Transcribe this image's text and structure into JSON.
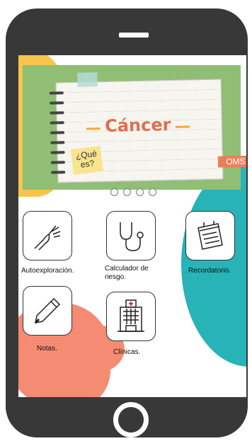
{
  "banner": {
    "title": "Cáncer",
    "sticky": "¿Qué es?",
    "badge": "OMS"
  },
  "carousel": {
    "pages": 4
  },
  "menu": [
    {
      "label": "Autoexploración.",
      "icon": "hand-icon"
    },
    {
      "label": "Calculador de riesgo.",
      "icon": "stethoscope-icon"
    },
    {
      "label": "Recordatorio.",
      "icon": "calendar-icon"
    },
    {
      "label": "Notas.",
      "icon": "pencil-icon"
    },
    {
      "label": "Clínicas.",
      "icon": "hospital-icon"
    }
  ],
  "colors": {
    "teal": "#27b3b7",
    "coral": "#f58b73",
    "yellow": "#f7c54b",
    "banner_green": "#8fbe74"
  }
}
